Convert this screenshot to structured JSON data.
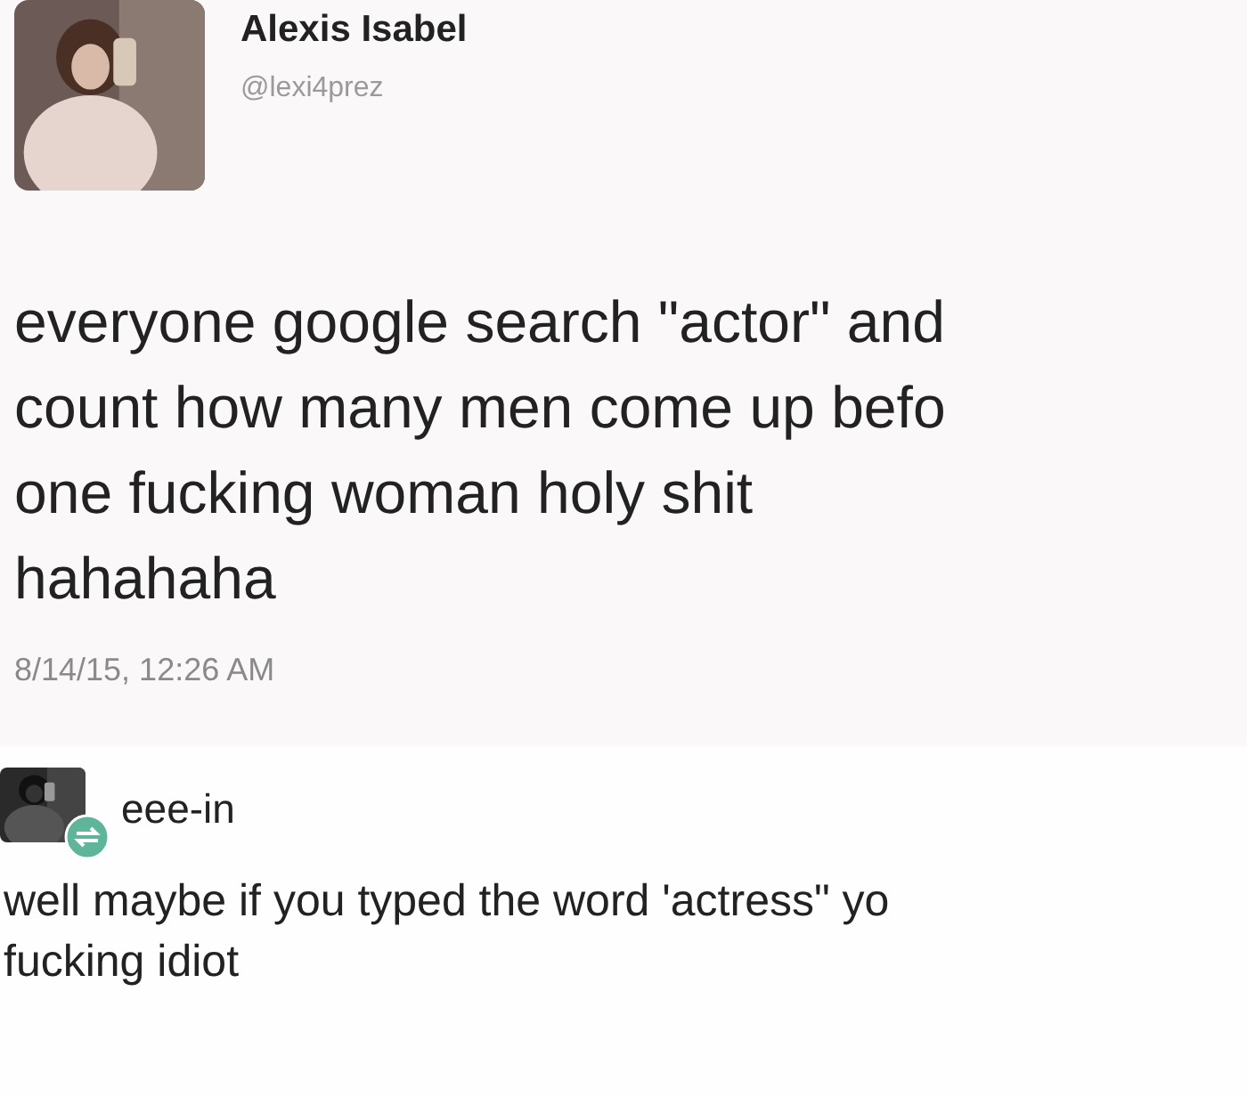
{
  "tweet": {
    "author": {
      "name": "Alexis Isabel",
      "handle": "@lexi4prez"
    },
    "lines": [
      "everyone google search \"actor\" and",
      "count how many men come up befo",
      "one fucking woman holy shit",
      "hahahaha"
    ],
    "timestamp": "8/14/15, 12:26 AM"
  },
  "reply": {
    "author": {
      "name": "eee-in",
      "reblogged": true
    },
    "lines": [
      "well maybe if you typed the word 'actress\" yo",
      "fucking idiot"
    ]
  }
}
